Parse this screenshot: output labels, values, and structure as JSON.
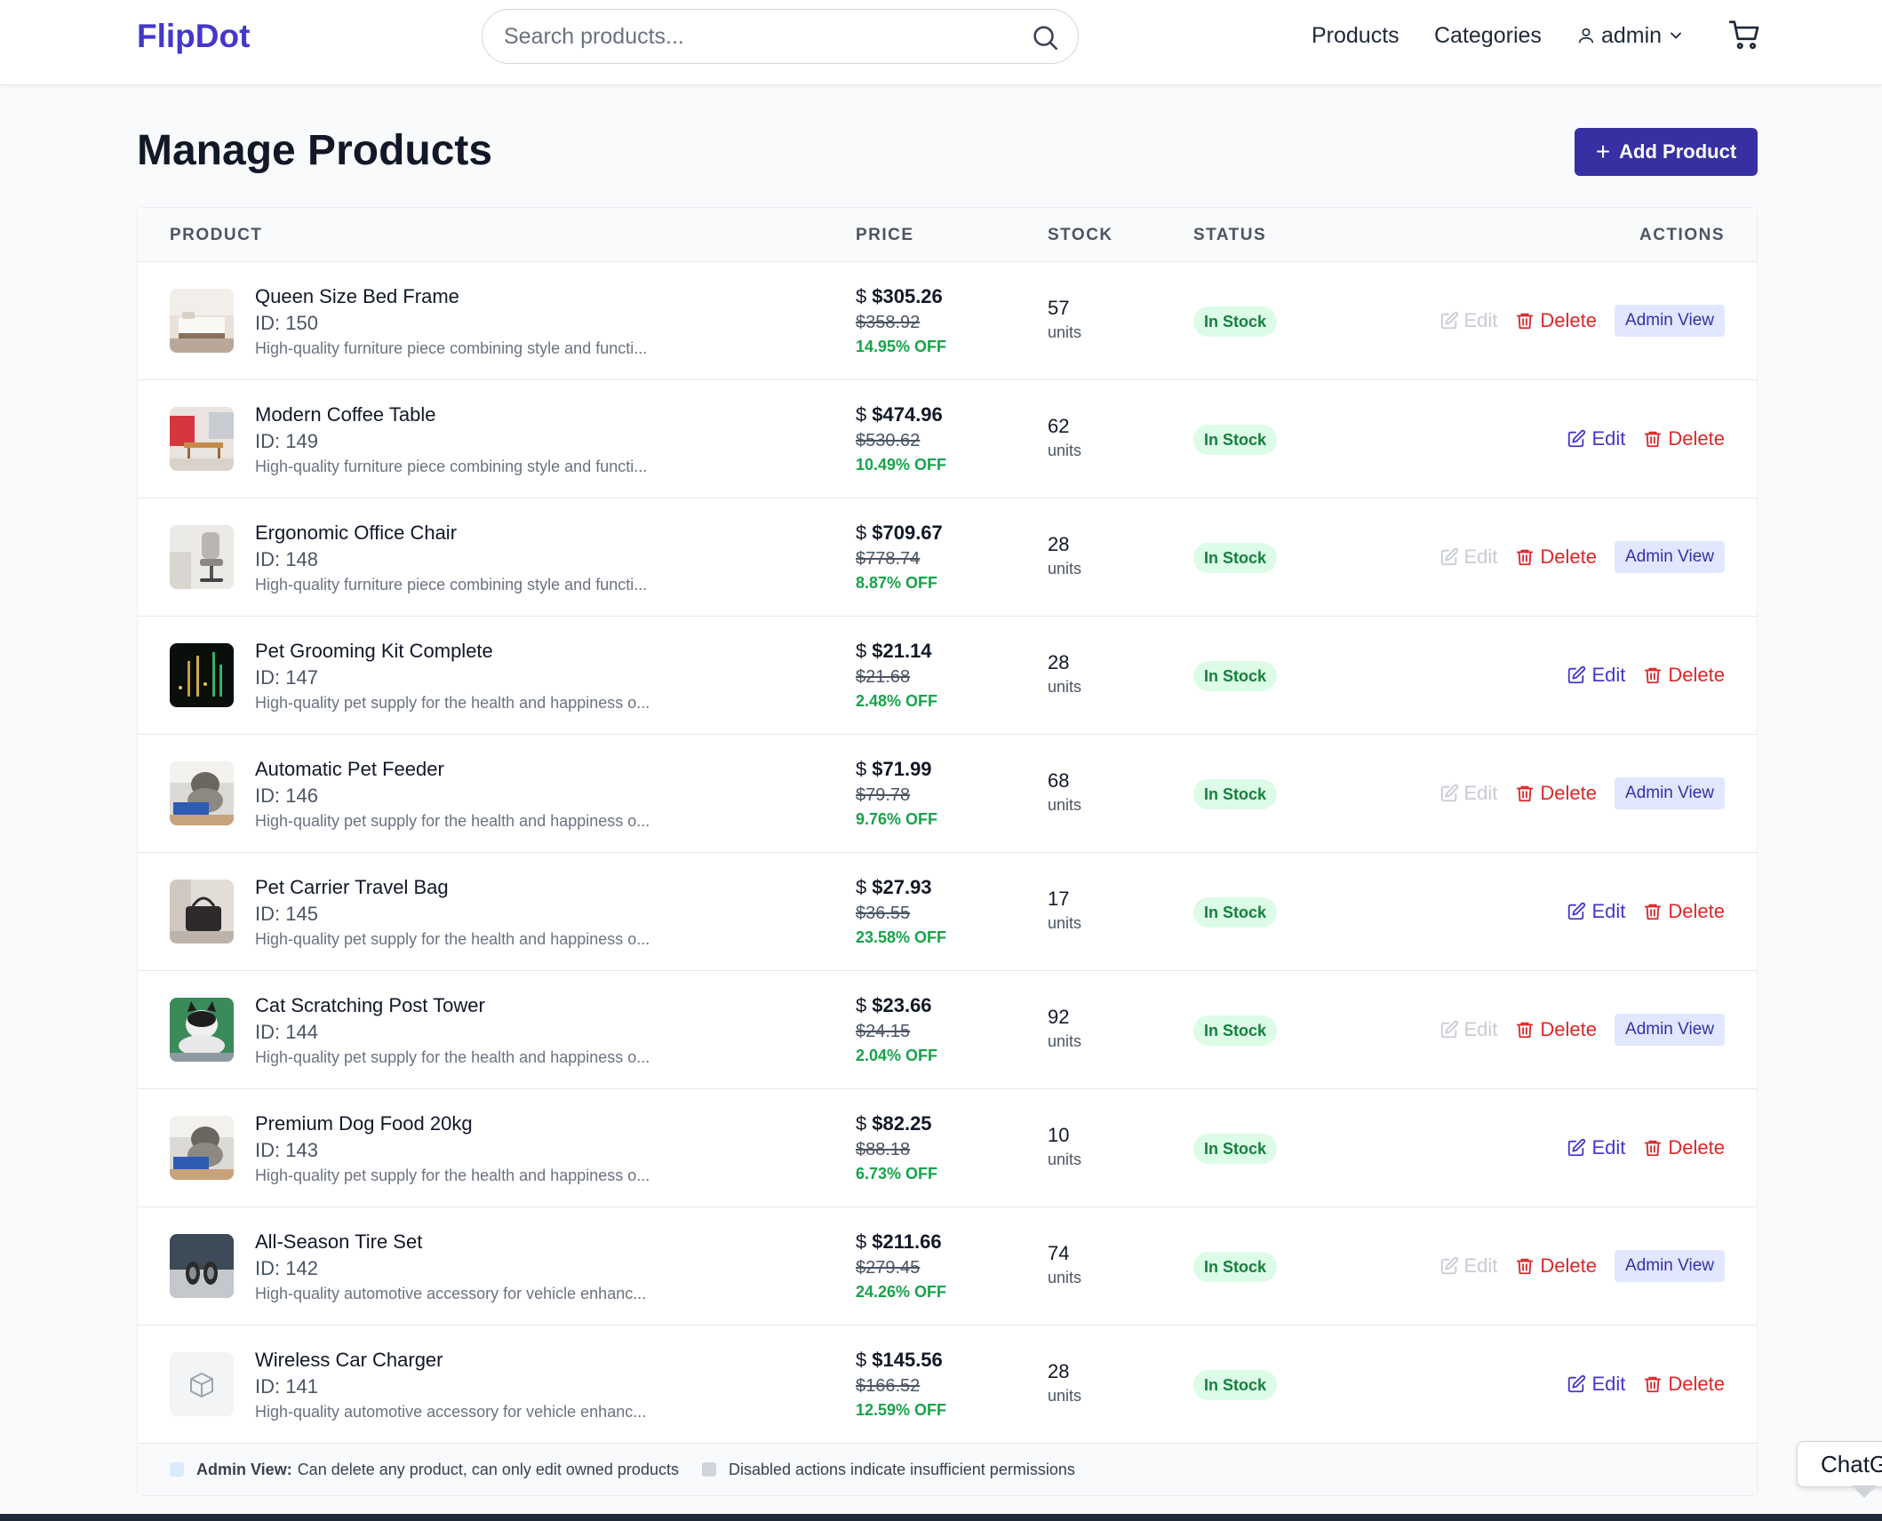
{
  "header": {
    "logo": "FlipDot",
    "search_placeholder": "Search products...",
    "nav_products": "Products",
    "nav_categories": "Categories",
    "user": "admin"
  },
  "page": {
    "title": "Manage Products",
    "add_button": "Add Product"
  },
  "table": {
    "headers": {
      "product": "PRODUCT",
      "price": "PRICE",
      "stock": "STOCK",
      "status": "STATUS",
      "actions": "ACTIONS"
    },
    "edit_label": "Edit",
    "delete_label": "Delete",
    "admin_view_label": "Admin View",
    "rows": [
      {
        "name": "Queen Size Bed Frame",
        "id": "ID: 150",
        "desc": "High-quality furniture piece combining style and functi...",
        "price": "$305.26",
        "original": "$358.92",
        "discount": "14.95% OFF",
        "stock": "57",
        "units": "units",
        "status": "In Stock",
        "edit_enabled": false,
        "admin_view": true,
        "thumb": "bed"
      },
      {
        "name": "Modern Coffee Table",
        "id": "ID: 149",
        "desc": "High-quality furniture piece combining style and functi...",
        "price": "$474.96",
        "original": "$530.62",
        "discount": "10.49% OFF",
        "stock": "62",
        "units": "units",
        "status": "In Stock",
        "edit_enabled": true,
        "admin_view": false,
        "thumb": "table"
      },
      {
        "name": "Ergonomic Office Chair",
        "id": "ID: 148",
        "desc": "High-quality furniture piece combining style and functi...",
        "price": "$709.67",
        "original": "$778.74",
        "discount": "8.87% OFF",
        "stock": "28",
        "units": "units",
        "status": "In Stock",
        "edit_enabled": false,
        "admin_view": true,
        "thumb": "chair"
      },
      {
        "name": "Pet Grooming Kit Complete",
        "id": "ID: 147",
        "desc": "High-quality pet supply for the health and happiness o...",
        "price": "$21.14",
        "original": "$21.68",
        "discount": "2.48% OFF",
        "stock": "28",
        "units": "units",
        "status": "In Stock",
        "edit_enabled": true,
        "admin_view": false,
        "thumb": "night"
      },
      {
        "name": "Automatic Pet Feeder",
        "id": "ID: 146",
        "desc": "High-quality pet supply for the health and happiness o...",
        "price": "$71.99",
        "original": "$79.78",
        "discount": "9.76% OFF",
        "stock": "68",
        "units": "units",
        "status": "In Stock",
        "edit_enabled": false,
        "admin_view": true,
        "thumb": "cat"
      },
      {
        "name": "Pet Carrier Travel Bag",
        "id": "ID: 145",
        "desc": "High-quality pet supply for the health and happiness o...",
        "price": "$27.93",
        "original": "$36.55",
        "discount": "23.58% OFF",
        "stock": "17",
        "units": "units",
        "status": "In Stock",
        "edit_enabled": true,
        "admin_view": false,
        "thumb": "bag"
      },
      {
        "name": "Cat Scratching Post Tower",
        "id": "ID: 144",
        "desc": "High-quality pet supply for the health and happiness o...",
        "price": "$23.66",
        "original": "$24.15",
        "discount": "2.04% OFF",
        "stock": "92",
        "units": "units",
        "status": "In Stock",
        "edit_enabled": false,
        "admin_view": true,
        "thumb": "cat2"
      },
      {
        "name": "Premium Dog Food 20kg",
        "id": "ID: 143",
        "desc": "High-quality pet supply for the health and happiness o...",
        "price": "$82.25",
        "original": "$88.18",
        "discount": "6.73% OFF",
        "stock": "10",
        "units": "units",
        "status": "In Stock",
        "edit_enabled": true,
        "admin_view": false,
        "thumb": "cat"
      },
      {
        "name": "All-Season Tire Set",
        "id": "ID: 142",
        "desc": "High-quality automotive accessory for vehicle enhanc...",
        "price": "$211.66",
        "original": "$279.45",
        "discount": "24.26% OFF",
        "stock": "74",
        "units": "units",
        "status": "In Stock",
        "edit_enabled": false,
        "admin_view": true,
        "thumb": "tire"
      },
      {
        "name": "Wireless Car Charger",
        "id": "ID: 141",
        "desc": "High-quality automotive accessory for vehicle enhanc...",
        "price": "$145.56",
        "original": "$166.52",
        "discount": "12.59% OFF",
        "stock": "28",
        "units": "units",
        "status": "In Stock",
        "edit_enabled": true,
        "admin_view": false,
        "thumb": "placeholder"
      }
    ]
  },
  "legend": {
    "admin_bold": "Admin View:",
    "admin_text": "Can delete any product, can only edit owned products",
    "disabled_text": "Disabled actions indicate insufficient permissions"
  },
  "chat": {
    "label": "ChatG"
  },
  "colors": {
    "brand": "#4338ca",
    "button": "#3730a3",
    "danger": "#dc2626",
    "success": "#16a34a",
    "badge_bg": "#dcfce7"
  }
}
